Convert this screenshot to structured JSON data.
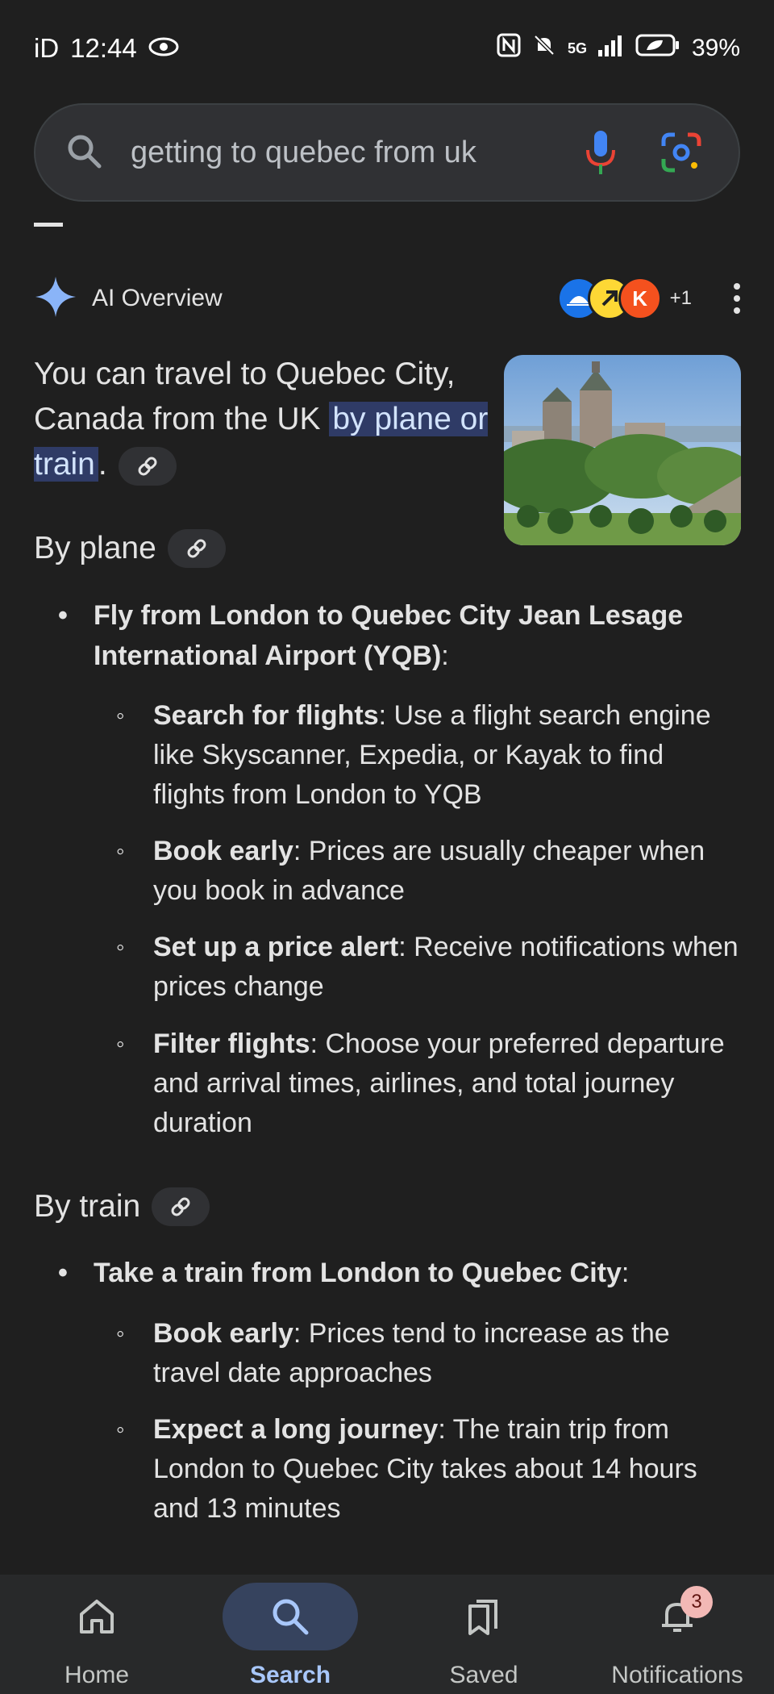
{
  "status_bar": {
    "carrier": "iD",
    "time": "12:44",
    "network": "5G",
    "battery": "39%"
  },
  "search": {
    "query": "getting to quebec from uk"
  },
  "ai_overview": {
    "title": "AI Overview",
    "extra_sources": "+1",
    "intro_prefix": "You can travel to Quebec City, Canada from the UK ",
    "intro_highlight": "by plane or train",
    "intro_suffix": ".",
    "sections": [
      {
        "title": "By plane",
        "bullet_bold": "Fly from London to Quebec City Jean Lesage International Airport (YQB)",
        "bullet_suffix": ":",
        "subitems": [
          {
            "bold": "Search for flights",
            "text": ": Use a flight search engine like Skyscanner, Expedia, or Kayak to find flights from London to YQB"
          },
          {
            "bold": "Book early",
            "text": ": Prices are usually cheaper when you book in advance"
          },
          {
            "bold": "Set up a price alert",
            "text": ": Receive notifications when prices change"
          },
          {
            "bold": "Filter flights",
            "text": ": Choose your preferred departure and arrival times, airlines, and total journey duration"
          }
        ]
      },
      {
        "title": "By train",
        "bullet_bold": "Take a train from London to Quebec City",
        "bullet_suffix": ":",
        "subitems": [
          {
            "bold": "Book early",
            "text": ": Prices tend to increase as the travel date approaches"
          },
          {
            "bold": "Expect a long journey",
            "text": ": The train trip from London to Quebec City takes about 14 hours and 13 minutes"
          }
        ]
      }
    ]
  },
  "bottom_nav": {
    "items": [
      {
        "label": "Home",
        "icon": "home-icon"
      },
      {
        "label": "Search",
        "icon": "search-icon",
        "active": true
      },
      {
        "label": "Saved",
        "icon": "bookmarks-icon"
      },
      {
        "label": "Notifications",
        "icon": "bell-icon",
        "badge": "3"
      }
    ]
  },
  "colors": {
    "background": "#1f1f1f",
    "highlight": "#2f3b66",
    "accent": "#a8c7fa"
  }
}
